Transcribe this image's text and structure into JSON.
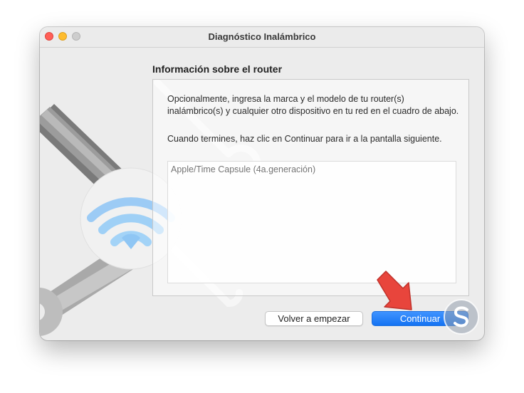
{
  "window": {
    "title": "Diagnóstico Inalámbrico",
    "controls": [
      "close",
      "minimize",
      "zoom"
    ]
  },
  "section": {
    "title": "Información sobre el router"
  },
  "panel": {
    "paragraph1": "Opcionalmente, ingresa la marca y el modelo de tu router(s) inalámbrico(s) y cualquier otro dispositivo en tu red en el cuadro de abajo.",
    "paragraph2": "Cuando termines, haz clic en Continuar para ir a la pantalla siguiente.",
    "router_field": {
      "value": "",
      "placeholder": "Apple/Time Capsule (4a.generación)"
    }
  },
  "buttons": {
    "restart_label": "Volver a empezar",
    "continue_label": "Continuar"
  },
  "icons": {
    "illustration": "wrench-screwdriver-wifi-icon",
    "annotation": "red-arrow-icon",
    "watermark": "watermark-logo"
  },
  "colors": {
    "accent": "#1a7cf5",
    "close": "#ff5f57",
    "minimize": "#febc2e",
    "annotation_arrow": "#e8453c"
  }
}
